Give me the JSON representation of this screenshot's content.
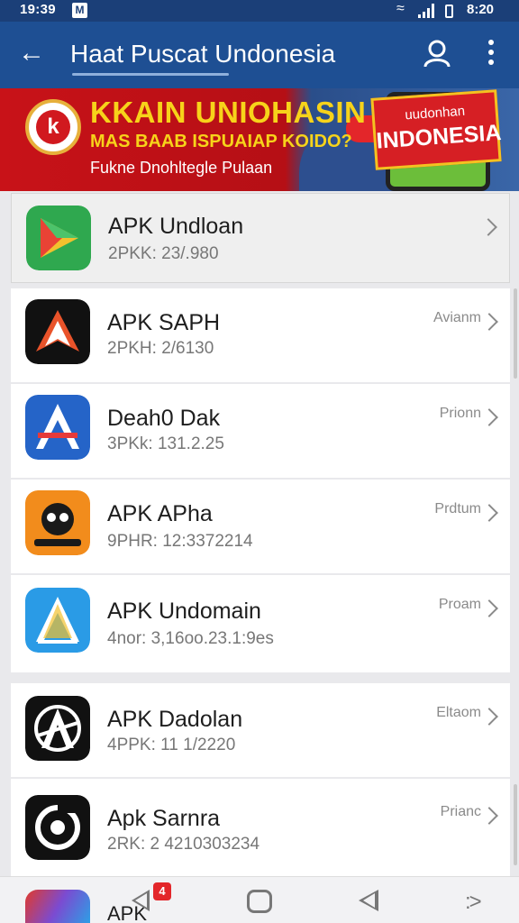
{
  "status_bar": {
    "time": "19:39",
    "time_right": "8:20"
  },
  "app_bar": {
    "title": "Haat Puscat Undonesia"
  },
  "banner": {
    "headline": "KKAIN UNIOHASIN",
    "subheadline": "MAS BAAB ISPUAIAP KOIDO?",
    "tagline": "Fukne Dnohltegle Pulaan",
    "badge_line1": "uudonhan",
    "badge_line2": "INDONESIA"
  },
  "apps": [
    {
      "name": "APK Undloan",
      "detail": "2PKK: 23/.980",
      "action": ""
    },
    {
      "name": "APK SAPH",
      "detail": "2PKH: 2/6130",
      "action": "Avianm"
    },
    {
      "name": "Deah0 Dak",
      "detail": "3PKk: 131.2.25",
      "action": "Prionn"
    },
    {
      "name": "APK APha",
      "detail": "9PHR: 12:3372214",
      "action": "Prdtum"
    },
    {
      "name": "APK Undomain",
      "detail": "4nor: 3,16oo.23.1:9es",
      "action": "Proam"
    },
    {
      "name": "APK Dadolan",
      "detail": "4PPK: 11 1/2220",
      "action": "Eltaom"
    },
    {
      "name": "Apk Sarnra",
      "detail": "2RK: 2 4210303234",
      "action": "Prianc"
    }
  ],
  "peek_item": {
    "name": "APK"
  },
  "nav_badge": "4"
}
